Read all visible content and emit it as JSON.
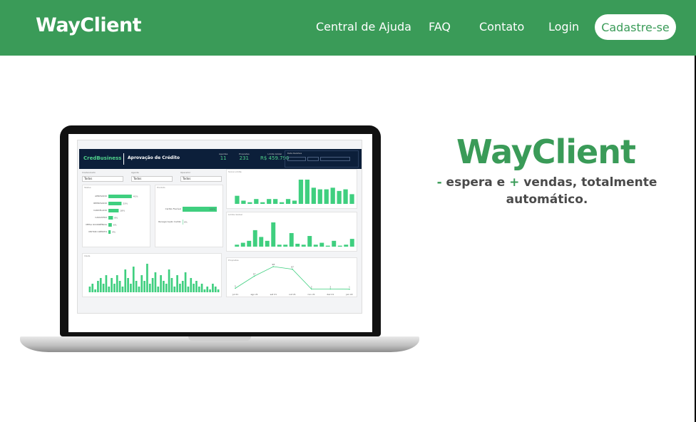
{
  "header": {
    "logo": "WayClient",
    "nav": {
      "help": "Central de Ajuda",
      "faq": "FAQ",
      "contact": "Contato",
      "login": "Login",
      "signup": "Cadastre-se"
    },
    "bg_color": "#3a9b58"
  },
  "hero": {
    "title": "WayClient",
    "subtitle_minus": "-",
    "subtitle_part1": " espera e ",
    "subtitle_plus": "+",
    "subtitle_part2": " vendas, totalmente automático.",
    "accent_color": "#3a9b58"
  },
  "dashboard": {
    "brand": "CredBusiness",
    "title": "Aprovação de Crédito",
    "kpis": [
      {
        "label": "Agentes",
        "value": "11"
      },
      {
        "label": "Propostas",
        "value": "231"
      },
      {
        "label": "Limite Global",
        "value": "R$ 459.790"
      }
    ],
    "filter_label": "Data Relativa",
    "selects": [
      {
        "label": "Credenciado",
        "value": "Todos"
      },
      {
        "label": "Agente",
        "value": "Todos"
      },
      {
        "label": "Operador",
        "value": "Todos"
      }
    ],
    "panels": {
      "status": "Status",
      "produto": "Produto",
      "score": "Score Limite",
      "limite": "Limite Global",
      "idade": "Idade",
      "propostas": "Propostas"
    },
    "status_rows": [
      {
        "label": "APROVADO",
        "value": "41%",
        "frac": 0.41
      },
      {
        "label": "REPROVADO",
        "value": "23%",
        "frac": 0.23
      },
      {
        "label": "CANCELADO",
        "value": "18%",
        "frac": 0.18
      },
      {
        "label": "CADASTRO",
        "value": "8%",
        "frac": 0.08
      },
      {
        "label": "MESA OCORRÊNCIA",
        "value": "6%",
        "frac": 0.06
      },
      {
        "label": "MOTOR CRÉDITO",
        "value": "4%",
        "frac": 0.04
      }
    ],
    "produto_rows": [
      {
        "label": "Cartão Flexível",
        "value": "100%",
        "frac": 1.0
      },
      {
        "label": "Renegociação Cartão",
        "value": "0%",
        "frac": 0.0
      }
    ],
    "score_bars": [
      5,
      2,
      1,
      3,
      1,
      3,
      3,
      1,
      3,
      2,
      15,
      15,
      10,
      9,
      9,
      10,
      8,
      9,
      6
    ],
    "limite_bars": [
      2,
      4,
      6,
      17,
      10,
      6,
      25,
      2,
      2,
      14,
      3,
      2,
      11,
      2,
      4,
      1,
      6,
      1,
      2,
      8
    ],
    "idade_bars": [
      2,
      3,
      1,
      4,
      5,
      3,
      6,
      2,
      5,
      3,
      6,
      4,
      2,
      8,
      5,
      3,
      9,
      4,
      2,
      6,
      4,
      10,
      3,
      5,
      7,
      2,
      6,
      4,
      3,
      8,
      5,
      2,
      6,
      3,
      4,
      7,
      2,
      5,
      3,
      4,
      2,
      3,
      1,
      2,
      1,
      3,
      2,
      1
    ],
    "propostas_line": [
      5,
      57,
      98,
      87,
      2,
      2,
      1
    ],
    "propostas_x": [
      "jul 21",
      "ago 21",
      "set 21",
      "out 21",
      "nov 21",
      "dez 21",
      "jan 22"
    ]
  }
}
